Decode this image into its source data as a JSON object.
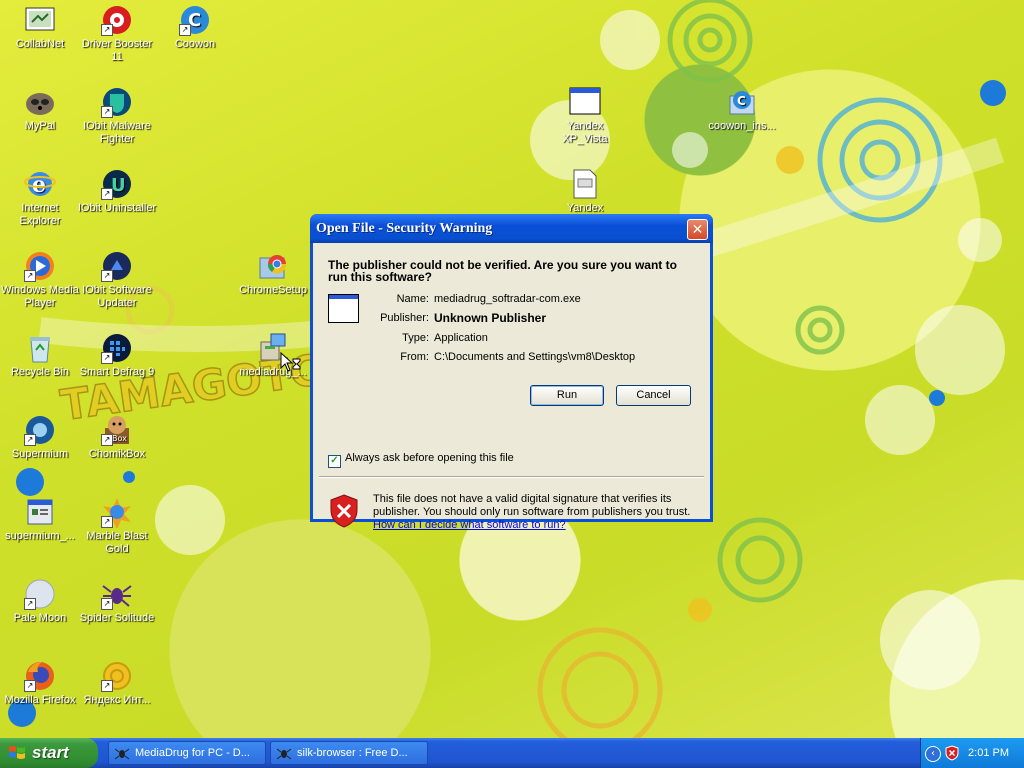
{
  "desktop": {
    "icons": [
      {
        "label": "CollabNet"
      },
      {
        "label": "Driver Booster 11"
      },
      {
        "label": "Coowon"
      },
      {
        "label": "MyPal"
      },
      {
        "label": "IObit Malware Fighter"
      },
      {
        "label": "Internet Explorer"
      },
      {
        "label": "IObit Uninstaller"
      },
      {
        "label": "Windows Media Player"
      },
      {
        "label": "IObit Software Updater"
      },
      {
        "label": "ChromeSetup"
      },
      {
        "label": "Recycle Bin"
      },
      {
        "label": "Smart Defrag 9"
      },
      {
        "label": "mediadrug_..."
      },
      {
        "label": "Supermium"
      },
      {
        "label": "ChomikBox"
      },
      {
        "label": "supermium_..."
      },
      {
        "label": "Marble Blast Gold"
      },
      {
        "label": "Pale Moon"
      },
      {
        "label": "Spider Solitude"
      },
      {
        "label": "Mozilla Firefox"
      },
      {
        "label": "Яндекс Инт..."
      },
      {
        "label": "Yandex XP_Vista"
      },
      {
        "label": "Yandex"
      },
      {
        "label": "coowon_ins..."
      }
    ]
  },
  "dialog": {
    "title": "Open File - Security Warning",
    "close_glyph": "✕",
    "question": "The publisher could not be verified.  Are you sure you want to run this software?",
    "fields": [
      {
        "key": "Name:",
        "value": "mediadrug_softradar-com.exe"
      },
      {
        "key": "Publisher:",
        "value": "Unknown Publisher"
      },
      {
        "key": "Type:",
        "value": "Application"
      },
      {
        "key": "From:",
        "value": "C:\\Documents and Settings\\vm8\\Desktop"
      }
    ],
    "run_label": "Run",
    "cancel_label": "Cancel",
    "checkbox_label": "Always ask before opening this file",
    "checkbox_checked": true,
    "warning_text": "This file does not have a valid digital signature that verifies its publisher.  You should only run software from publishers you trust.",
    "help_link": "How can I decide what software to run?"
  },
  "taskbar": {
    "start_label": "start",
    "tasks": [
      {
        "label": "MediaDrug for PC - D..."
      },
      {
        "label": "silk-browser : Free D..."
      }
    ],
    "tray_chevron": "‹",
    "clock": "2:01 PM"
  },
  "colors": {
    "taskbar": "#245edb",
    "start": "#3c9a3c",
    "dialog_frame": "#0a4fd6",
    "dialog_body": "#ece9d8"
  }
}
